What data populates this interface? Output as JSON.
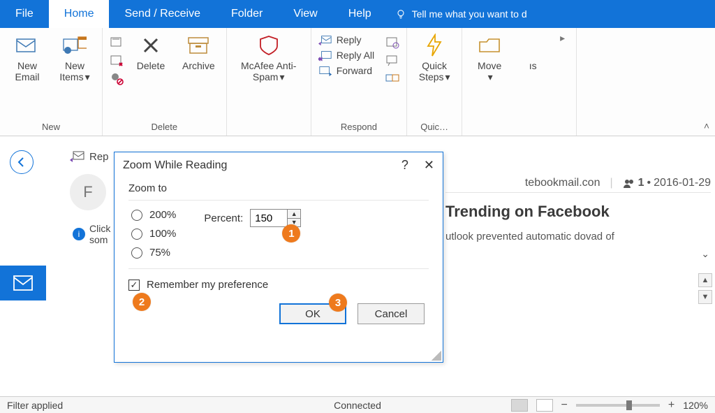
{
  "tabs": {
    "file": "File",
    "home": "Home",
    "send_receive": "Send / Receive",
    "folder": "Folder",
    "view": "View",
    "help": "Help",
    "tell_me": "Tell me what you want to d"
  },
  "ribbon": {
    "new": {
      "label": "New",
      "new_email": "New\nEmail",
      "new_items": "New\nItems"
    },
    "delete_group": {
      "label": "Delete",
      "delete": "Delete",
      "archive": "Archive"
    },
    "mcafee": {
      "label": "McAfee Anti-\nSpam"
    },
    "respond": {
      "label": "Respond",
      "reply": "Reply",
      "reply_all": "Reply All",
      "forward": "Forward"
    },
    "quick": {
      "label": "Quic…",
      "quick_steps": "Quick\nSteps"
    },
    "move": {
      "label": "Move",
      "js": "ıs"
    }
  },
  "message": {
    "reply_hint": "Rep",
    "avatar_letter": "F",
    "click_label": "Click",
    "click_line2": "som",
    "from_domain": "tebookmail.con",
    "people_count": "1",
    "date": "2016-01-29",
    "subject": "Trending on Facebook",
    "prevented": "utlook prevented automatic dovad of"
  },
  "dialog": {
    "title": "Zoom While Reading",
    "zoom_to": "Zoom to",
    "opt_200": "200%",
    "opt_100": "100%",
    "opt_75": "75%",
    "percent_label": "Percent:",
    "percent_value": "150",
    "remember": "Remember my preference",
    "ok": "OK",
    "cancel": "Cancel"
  },
  "callouts": {
    "c1": "1",
    "c2": "2",
    "c3": "3"
  },
  "status": {
    "filter": "Filter applied",
    "connected": "Connected",
    "zoom": "120%"
  }
}
